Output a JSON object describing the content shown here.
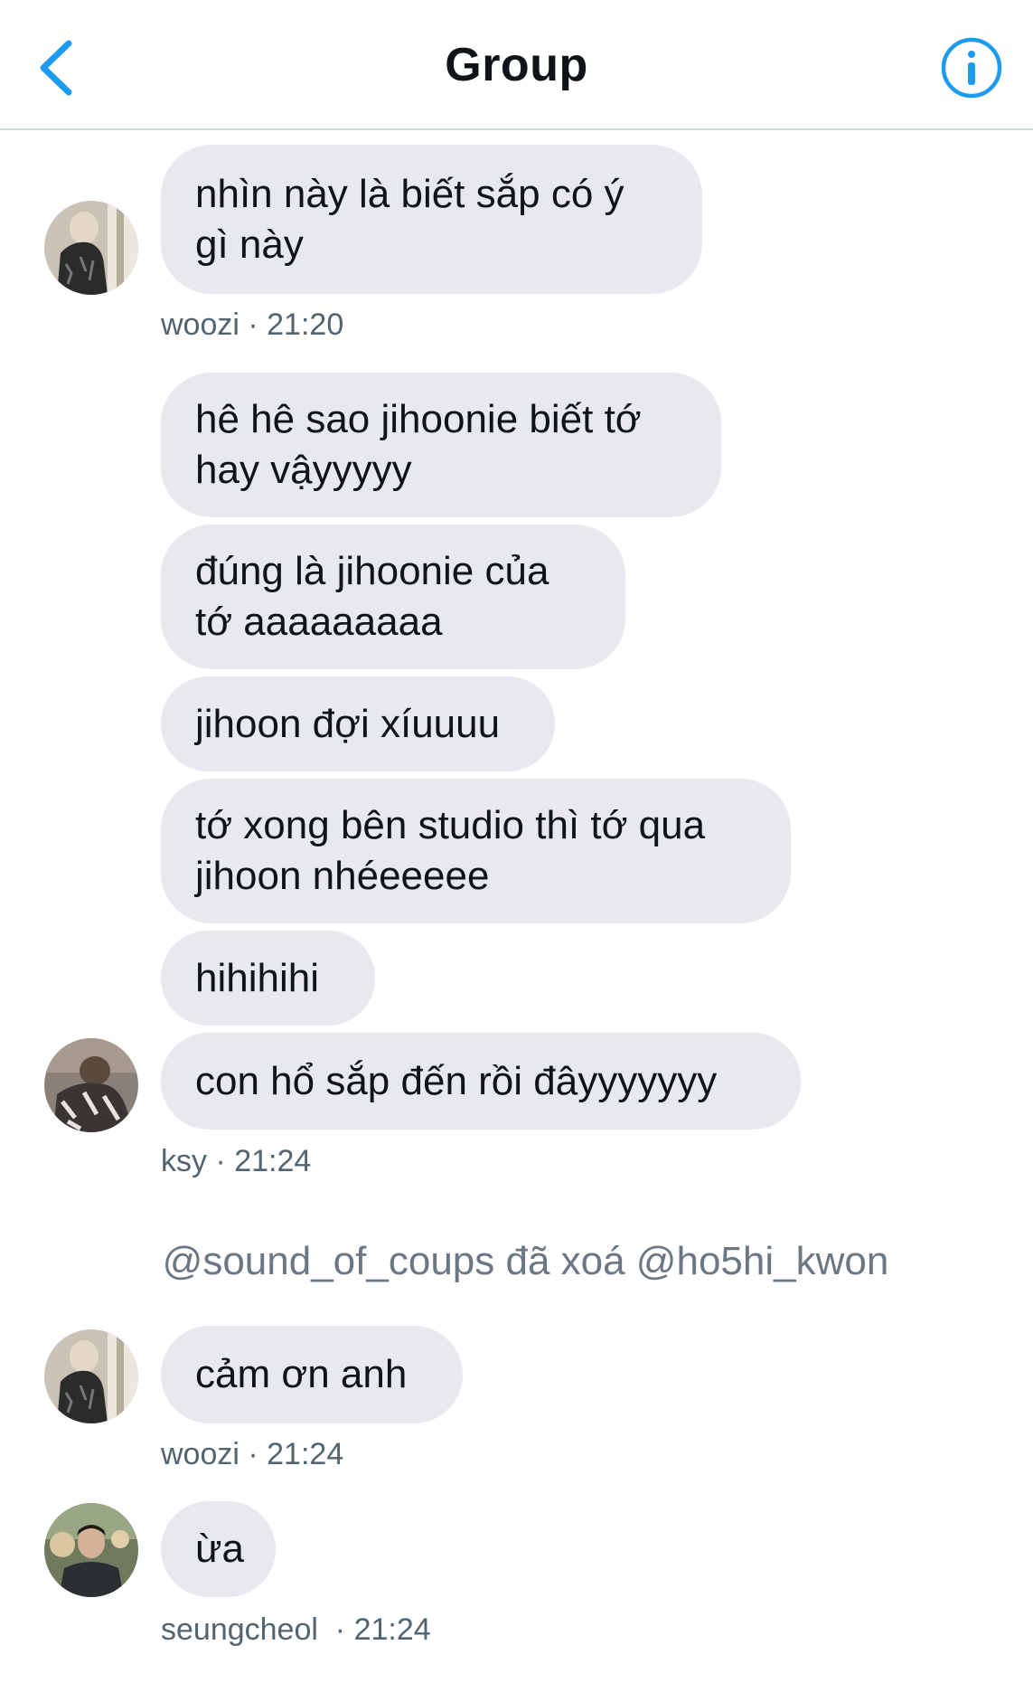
{
  "header": {
    "title": "Group",
    "back_icon": "chevron-left-icon",
    "info_icon": "info-circle-icon",
    "accent": "#1d9bf0"
  },
  "messages": [
    {
      "text": "nhìn này là biết sắp có ý\ngì này"
    },
    {
      "text": "hê hê sao jihoonie biết tớ\nhay vậyyyyy"
    },
    {
      "text": "đúng là jihoonie của\ntớ aaaaaaaaa"
    },
    {
      "text": "jihoon đợi xíuuuu"
    },
    {
      "text": "tớ xong bên studio thì tớ qua\njihoon nhéeeeee"
    },
    {
      "text": "hihihihi"
    },
    {
      "text": "con hổ sắp đến rồi đâyyyyyyy"
    },
    {
      "text": "cảm ơn anh"
    },
    {
      "text": "ừa"
    }
  ],
  "meta": [
    {
      "text": "woozi · 21:20"
    },
    {
      "text": "ksy · 21:24"
    },
    {
      "text": "woozi · 21:24"
    },
    {
      "text": "seungcheol  · 21:24"
    }
  ],
  "system": {
    "text": "@sound_of_coups đã xoá @ho5hi_kwon"
  },
  "colors": {
    "bubble": "#e7e9ee",
    "meta_text": "#536471",
    "divider": "#cfd9de"
  }
}
